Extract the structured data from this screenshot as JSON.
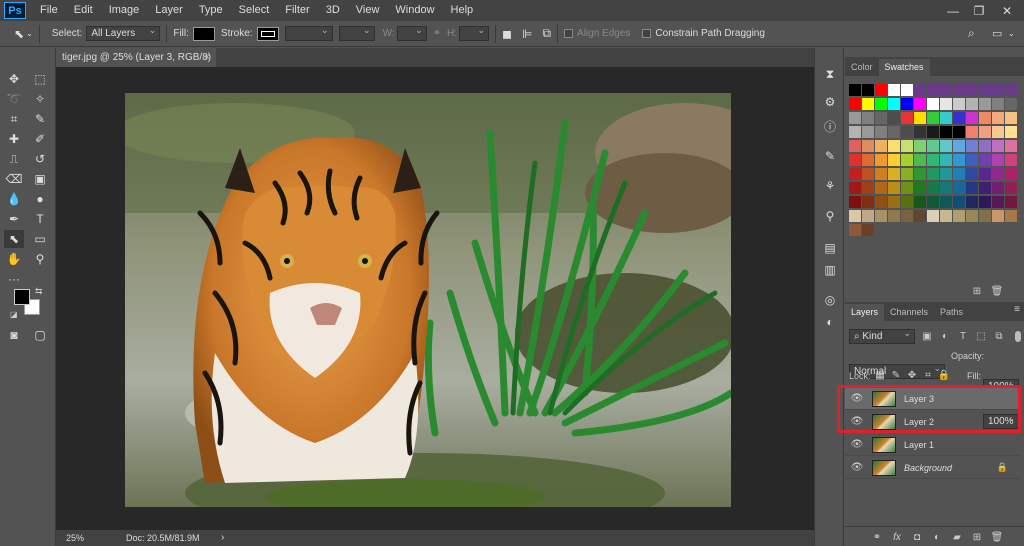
{
  "app": {
    "logo": "Ps"
  },
  "menubar": {
    "items": [
      "File",
      "Edit",
      "Image",
      "Layer",
      "Type",
      "Select",
      "Filter",
      "3D",
      "View",
      "Window",
      "Help"
    ]
  },
  "window_controls": {
    "minimize": "—",
    "restore": "❐",
    "close": "✕"
  },
  "options_bar": {
    "select_label": "Select:",
    "select_value": "All Layers",
    "fill_label": "Fill:",
    "stroke_label": "Stroke:",
    "w_label": "W:",
    "h_label": "H:",
    "align_edges": "Align Edges",
    "constrain": "Constrain Path Dragging",
    "fill_color": "#000000"
  },
  "document": {
    "tab_title": "tiger.jpg @ 25% (Layer 3, RGB/8) *",
    "close": "×",
    "zoom": "25%",
    "doc_size": "Doc: 20.5M/81.9M"
  },
  "color_panel": {
    "tabs": [
      "Color",
      "Swatches"
    ],
    "active": "Swatches"
  },
  "layers_panel": {
    "tabs": [
      "Layers",
      "Channels",
      "Paths"
    ],
    "kind_label": "Kind",
    "blend_mode": "Normal",
    "opacity_label": "Opacity:",
    "opacity_value": "100%",
    "lock_label": "Lock:",
    "fill_label": "Fill:",
    "fill_value": "100%",
    "layers": [
      {
        "name": "Layer 3",
        "selected": true
      },
      {
        "name": "Layer 2",
        "selected": false
      },
      {
        "name": "Layer 1",
        "selected": false
      },
      {
        "name": "Background",
        "selected": false,
        "locked": true
      }
    ]
  },
  "colors": {
    "highlight_box": "#e0202a",
    "foreground": "#000000",
    "background": "#ffffff"
  }
}
